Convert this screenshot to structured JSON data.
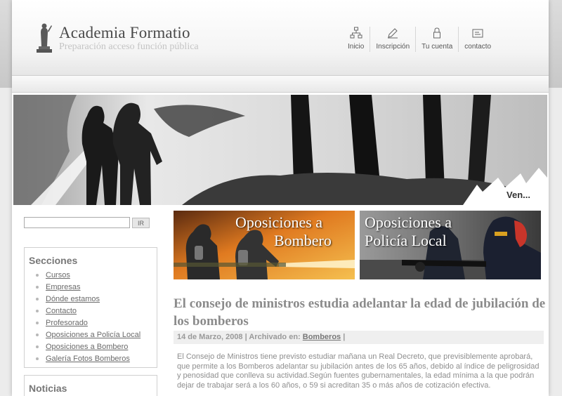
{
  "site": {
    "title": "Academia Formatio",
    "subtitle": "Preparación acceso función pública"
  },
  "nav": [
    {
      "label": "Inicio",
      "icon": "sitemap-icon"
    },
    {
      "label": "Inscripción",
      "icon": "pencil-icon"
    },
    {
      "label": "Tu cuenta",
      "icon": "lock-icon"
    },
    {
      "label": "contacto",
      "icon": "mailbox-icon"
    }
  ],
  "banner": {
    "more_label": "Ven..."
  },
  "search": {
    "button_label": "IR",
    "value": ""
  },
  "sections": {
    "title": "Secciones",
    "items": [
      "Cursos",
      "Empresas",
      "Dónde estamos",
      "Contacto",
      "Profesorado",
      "Oposiciones a Policía Local",
      "Oposiciones a Bombero",
      "Galería Fotos Bomberos"
    ]
  },
  "news": {
    "title": "Noticias"
  },
  "promos": [
    {
      "line1": "Oposiciones a",
      "line2": "Bombero"
    },
    {
      "line1": "Oposiciones a",
      "line2": "Policía Local"
    }
  ],
  "article": {
    "title": "El consejo de ministros estudia adelantar la edad de jubilación de los bomberos",
    "date": "14 de Marzo, 2008",
    "archived_prefix": "| Archivado en:",
    "category": "Bomberos",
    "archived_suffix": "|",
    "body": "El Consejo de Ministros tiene previsto estudiar mañana un Real Decreto, que previsiblemente aprobará, que permite a los Bomberos adelantar su jubilación antes de los 65 años, debido al índice de peligrosidad y penosidad que conlleva su actividad.Según fuentes gubernamentales, la edad mínima a la que podrán dejar de trabajar será a los 60 años, o 59 si acreditan 35 o más años de cotización efectiva."
  },
  "colors": {
    "accent_text": "#8b8b8b",
    "link": "#6a6a6a",
    "background": "#ececec"
  }
}
